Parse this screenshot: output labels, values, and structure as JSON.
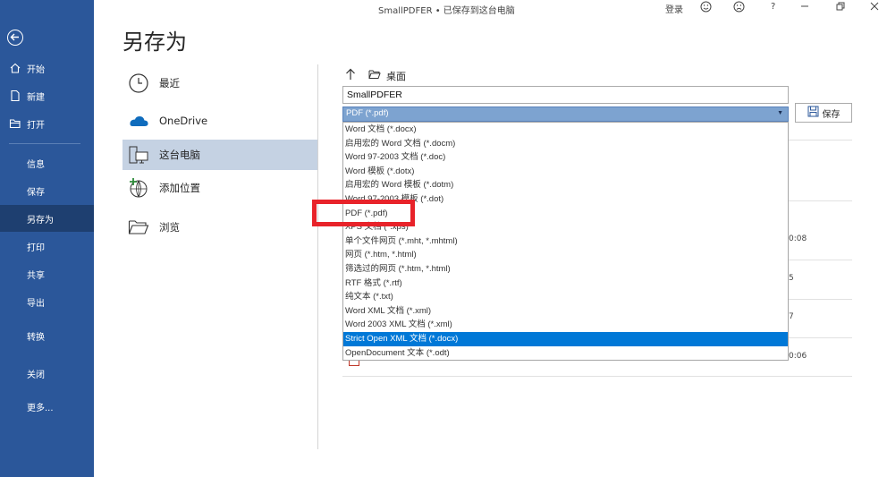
{
  "window": {
    "title": "SmallPDFER • 已保存到这台电脑",
    "signin": "登录",
    "help": "?"
  },
  "nav": {
    "items": [
      {
        "label": "开始",
        "icon": "home-icon"
      },
      {
        "label": "新建",
        "icon": "new-document-icon"
      },
      {
        "label": "打开",
        "icon": "open-folder-icon"
      },
      {
        "label": "信息"
      },
      {
        "label": "保存"
      },
      {
        "label": "另存为",
        "active": true
      },
      {
        "label": "打印"
      },
      {
        "label": "共享"
      },
      {
        "label": "导出"
      },
      {
        "label": "转换"
      },
      {
        "label": "关闭"
      },
      {
        "label": "更多..."
      }
    ]
  },
  "page_title": "另存为",
  "locations": [
    {
      "label": "最近",
      "icon": "clock-icon"
    },
    {
      "label": "OneDrive",
      "icon": "onedrive-cloud-icon"
    },
    {
      "label": "这台电脑",
      "icon": "computer-icon",
      "active": true
    },
    {
      "label": "添加位置",
      "icon": "add-location-icon"
    },
    {
      "label": "浏览",
      "icon": "browse-folder-icon"
    }
  ],
  "path": {
    "folder": "桌面"
  },
  "filename": {
    "value": "SmallPDFER"
  },
  "filetype": {
    "selected": "PDF (*.pdf)"
  },
  "save_button": "保存",
  "file_list_fragments": [
    "0:08",
    "5",
    "7",
    "0:06"
  ],
  "dropdown": {
    "options": [
      "Word 文档 (*.docx)",
      "启用宏的 Word 文档 (*.docm)",
      "Word 97-2003 文档 (*.doc)",
      "Word 模板 (*.dotx)",
      "启用宏的 Word 模板 (*.dotm)",
      "Word 97-2003 模板 (*.dot)",
      "PDF (*.pdf)",
      "XPS 文档 (*.xps)",
      "单个文件网页 (*.mht, *.mhtml)",
      "网页 (*.htm, *.html)",
      "筛选过的网页 (*.htm, *.html)",
      "RTF 格式 (*.rtf)",
      "纯文本 (*.txt)",
      "Word XML 文档 (*.xml)",
      "Word 2003 XML 文档 (*.xml)",
      "Strict Open XML 文档 (*.docx)",
      "OpenDocument 文本 (*.odt)"
    ],
    "highlighted_index": 15
  },
  "colors": {
    "nav_bg": "#2b579a",
    "nav_active": "#1e3f70",
    "selection": "#0078d7",
    "combo_bg": "#7da3d0",
    "annotation_red": "#e8232a"
  }
}
